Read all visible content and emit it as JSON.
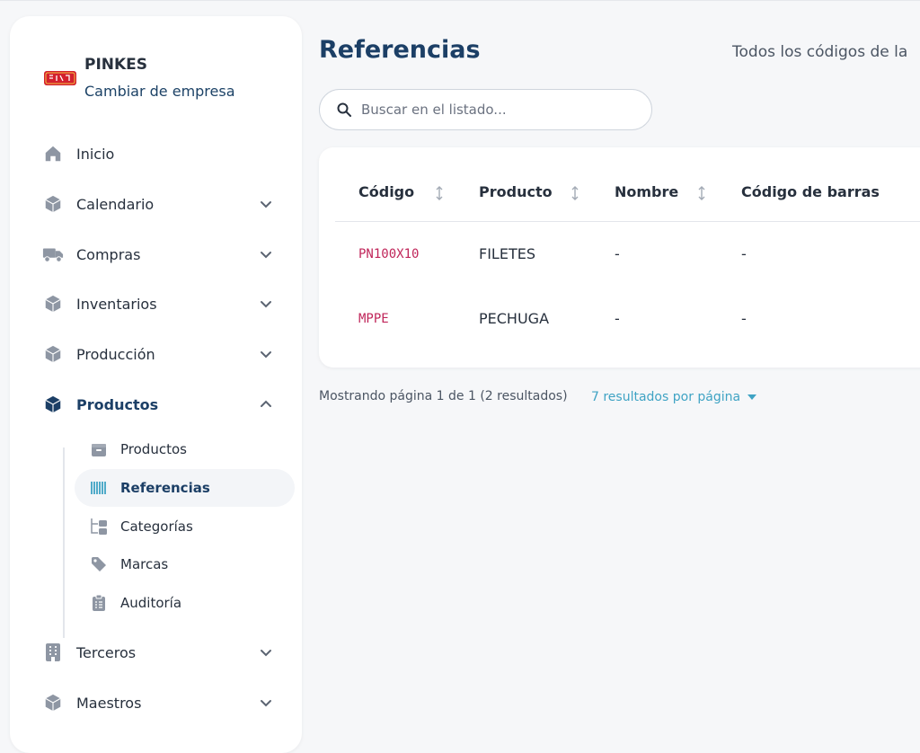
{
  "company": {
    "name": "PINKES",
    "switch_label": "Cambiar de empresa",
    "logo_text": "PINKES"
  },
  "sidebar": {
    "items": [
      {
        "label": "Inicio",
        "icon": "home-icon"
      },
      {
        "label": "Calendario",
        "icon": "cube-icon",
        "expandable": true
      },
      {
        "label": "Compras",
        "icon": "truck-icon",
        "expandable": true
      },
      {
        "label": "Inventarios",
        "icon": "cube-icon",
        "expandable": true
      },
      {
        "label": "Producción",
        "icon": "cube-icon",
        "expandable": true
      },
      {
        "label": "Productos",
        "icon": "cube-icon",
        "expandable": true,
        "expanded": true,
        "active": true
      },
      {
        "label": "Terceros",
        "icon": "building-icon",
        "expandable": true
      },
      {
        "label": "Maestros",
        "icon": "cube-icon",
        "expandable": true
      }
    ],
    "subitems": [
      {
        "label": "Productos",
        "icon": "box-icon"
      },
      {
        "label": "Referencias",
        "icon": "barcode-icon",
        "active": true
      },
      {
        "label": "Categorías",
        "icon": "tree-icon"
      },
      {
        "label": "Marcas",
        "icon": "tag-icon"
      },
      {
        "label": "Auditoría",
        "icon": "clipboard-icon"
      }
    ]
  },
  "page": {
    "title": "Referencias",
    "description": "Todos los códigos de la"
  },
  "search": {
    "placeholder": "Buscar en el listado...",
    "value": ""
  },
  "table": {
    "columns": [
      "Código",
      "Producto",
      "Nombre",
      "Código de barras"
    ],
    "rows": [
      {
        "codigo": "PN100X10",
        "producto": "FILETES",
        "nombre": "-",
        "barras": "-"
      },
      {
        "codigo": "MPPE",
        "producto": "PECHUGA",
        "nombre": "-",
        "barras": "-"
      }
    ]
  },
  "pagination": {
    "info": "Mostrando página 1 de 1 (2 resultados)",
    "per_page": "7 resultados por página"
  },
  "colors": {
    "primary": "#1c3f66",
    "code": "#c0265a",
    "link": "#3fa3c4",
    "icon": "#8e96a3",
    "logo_red": "#d3202e"
  }
}
